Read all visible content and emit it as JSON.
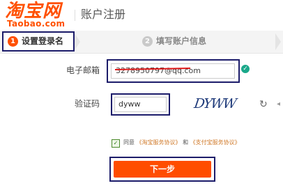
{
  "header": {
    "logo_cn": "淘宝网",
    "logo_en": "Taobao.com",
    "page_title": "账户注册"
  },
  "steps": [
    {
      "num": "1",
      "label": "设置登录名",
      "active": true
    },
    {
      "num": "2",
      "label": "填写账户信息",
      "active": false
    }
  ],
  "form": {
    "email_label": "电子邮箱",
    "email_value": "3278950797@qq.com",
    "email_valid_icon": "check-circle-icon",
    "captcha_label": "验证码",
    "captcha_value": "dyww",
    "captcha_image_text": "DYWW",
    "refresh_icon": "refresh-icon"
  },
  "agreement": {
    "prefix": "同意",
    "link1": "《淘宝服务协议》",
    "and": "和",
    "link2": "《支付宝服务协议》",
    "checked": true
  },
  "submit": {
    "label": "下一步"
  },
  "colors": {
    "brand": "#ff5000",
    "annotation_frame": "#1c1c6a",
    "valid": "#1aa88a",
    "link": "#d07a2a"
  }
}
